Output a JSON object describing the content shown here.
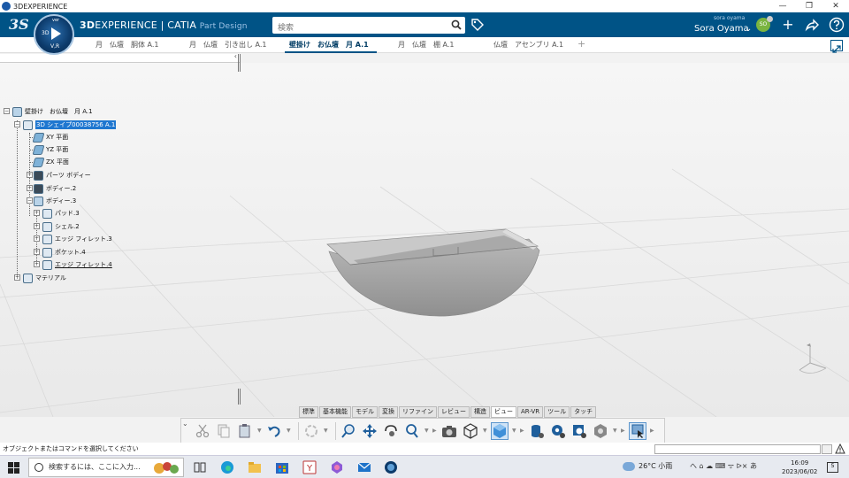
{
  "window": {
    "title": "3DEXPERIENCE",
    "minimize": "—",
    "restore": "❐",
    "close": "✕"
  },
  "appbar": {
    "logo": "3S",
    "brand_bold": "3D",
    "brand_main": "EXPERIENCE | CATIA",
    "brand_sub": "Part Design",
    "compass_3d": "3D",
    "compass_v": "V,R",
    "compass_ver": "ver",
    "search_placeholder": "検索",
    "user_small": "sora oyama",
    "user_name": "Sora Oyama",
    "user_initials": "SO",
    "icons": [
      "tag-icon",
      "plus-icon",
      "share-icon",
      "help-icon"
    ]
  },
  "tabs": [
    {
      "label": "月　仏壇　胴体 A.1",
      "active": false
    },
    {
      "label": "月　仏壇　引き出し A.1",
      "active": false
    },
    {
      "label": "壁掛け　お仏壇　月 A.1",
      "active": true
    },
    {
      "label": "月　仏壇　棚 A.1",
      "active": false
    },
    {
      "label": "仏壇　アセンブリ A.1",
      "active": false
    }
  ],
  "tab_add": "+",
  "tree": {
    "root": "壁掛け　お仏壇　月 A.1",
    "shape": "3D シェイプ00038756 A.1",
    "items": [
      {
        "label": "XY 平面",
        "icon": "plane-icon"
      },
      {
        "label": "YZ 平面",
        "icon": "plane-icon"
      },
      {
        "label": "ZX 平面",
        "icon": "plane-icon"
      },
      {
        "label": "パーツ ボディー",
        "icon": "body-icon"
      },
      {
        "label": "ボディー.2",
        "icon": "body-icon"
      },
      {
        "label": "ボディー.3",
        "icon": "body-icon"
      },
      {
        "label": "パッド.3",
        "icon": "pad-icon"
      },
      {
        "label": "シェル.2",
        "icon": "shell-icon"
      },
      {
        "label": "エッジ フィレット.3",
        "icon": "fillet-icon"
      },
      {
        "label": "ポケット.4",
        "icon": "pocket-icon"
      },
      {
        "label": "エッジ フィレット.4",
        "icon": "fillet-icon"
      },
      {
        "label": "マテリアル",
        "icon": "material-icon"
      }
    ]
  },
  "action_tabs": [
    {
      "label": "標準",
      "active": false
    },
    {
      "label": "基本機能",
      "active": false
    },
    {
      "label": "モデル",
      "active": false
    },
    {
      "label": "変換",
      "active": false
    },
    {
      "label": "リファイン",
      "active": false
    },
    {
      "label": "レビュー",
      "active": false
    },
    {
      "label": "構造",
      "active": false
    },
    {
      "label": "ビュー",
      "active": true
    },
    {
      "label": "AR-VR",
      "active": false
    },
    {
      "label": "ツール",
      "active": false
    },
    {
      "label": "タッチ",
      "active": false
    }
  ],
  "status": {
    "message": "オブジェクトまたはコマンドを選択してください"
  },
  "taskbar": {
    "search_placeholder": "検索するには、ここに入力...",
    "weather": "26°C  小雨",
    "tray": "へ ⌂ ☁ ⌨ ᯤ ᐅ× あ",
    "time": "16:09",
    "date": "2023/06/02",
    "notif_count": "5"
  }
}
